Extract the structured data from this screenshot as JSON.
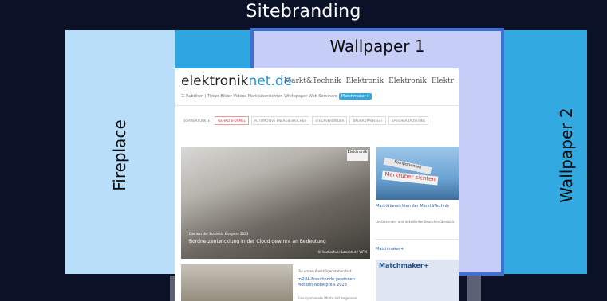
{
  "title": "Sitebranding",
  "zones": {
    "fireplace": "Fireplace",
    "wallpaper1": "Wallpaper 1",
    "wallpaper2": "Wallpaper 2"
  },
  "colors": {
    "background": "#0b1228",
    "fireplace": "#b9defa",
    "wallpaper1_fill": "#c6cdf6",
    "wallpaper1_border": "#3f6fd2",
    "wallpaper2": "#33a9e2",
    "sitebar": "#2ea7e0"
  },
  "site": {
    "logo_main": "elektronik",
    "logo_accent": "net.de",
    "brands": [
      "Markt&Technik",
      "Elektronik",
      "Elektronik",
      "Elektr"
    ],
    "nav": "☰ Rubriken | Ticker  Bilder  Videos  Marktübersichten  Whitepaper  Web Seminare",
    "nav_pill": "Matchmaker+",
    "tags": [
      "SCHWERPUNKTE",
      "GEHALTSFORMEL",
      "AUTOMOTIVE ENERGIESPEICHER",
      "STECKVERBINDER",
      "BAUGRUPPENTEST",
      "SPEICHERBAUSTEINE"
    ],
    "hero_badge": "Elektronik",
    "hero_sub": "Das war der Bordnetz Kongress 2023",
    "hero_caption": "Bordnetzentwicklung in der Cloud gewinnt an Bedeutung",
    "hero_credit": "© Hochschule Landshut / WFM",
    "side_sign1": "Komponenten",
    "side_sign2": "Marktüber sichten",
    "side_title": "Marktübersichten der Markt&Technik",
    "side_text": "Umfassender und detaillierter Branchenüberblick",
    "match_label": "Matchmaker+",
    "match_card": "Matchmaker+",
    "bottom_text1": "Die ersten Preisträger stehen fest",
    "bottom_text2": "mRNA-Forschende gewinnen Medizin-Nobelpreis 2023",
    "bottom_text3": "Eine spannende Pforte hat begonnen"
  }
}
